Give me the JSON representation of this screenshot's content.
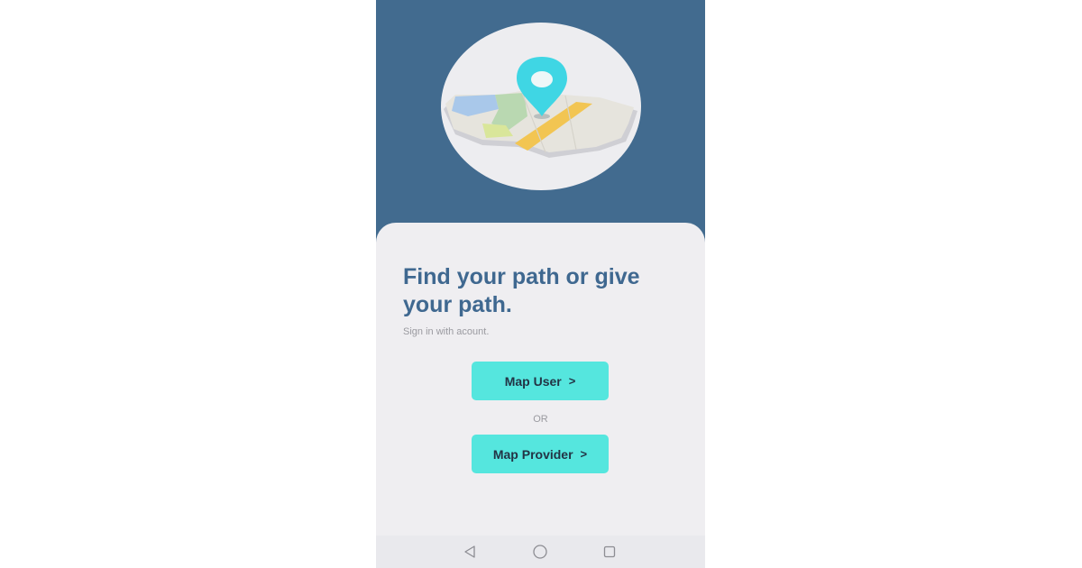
{
  "hero": {
    "icon": "map-with-location-pin-icon"
  },
  "card": {
    "headline": "Find your path or give your path.",
    "subtitle": "Sign in with acount."
  },
  "buttons": {
    "map_user_label": "Map User",
    "map_provider_label": "Map Provider",
    "chevron": ">"
  },
  "divider_text": "OR",
  "nav": {
    "back_icon": "back-triangle-icon",
    "home_icon": "home-circle-icon",
    "recent_icon": "recent-apps-square-icon"
  },
  "colors": {
    "header_background": "#426b8f",
    "card_background": "#efeef1",
    "headline_text": "#3f6890",
    "button_background": "#55e6de",
    "pin_color": "#3fd6e4"
  }
}
